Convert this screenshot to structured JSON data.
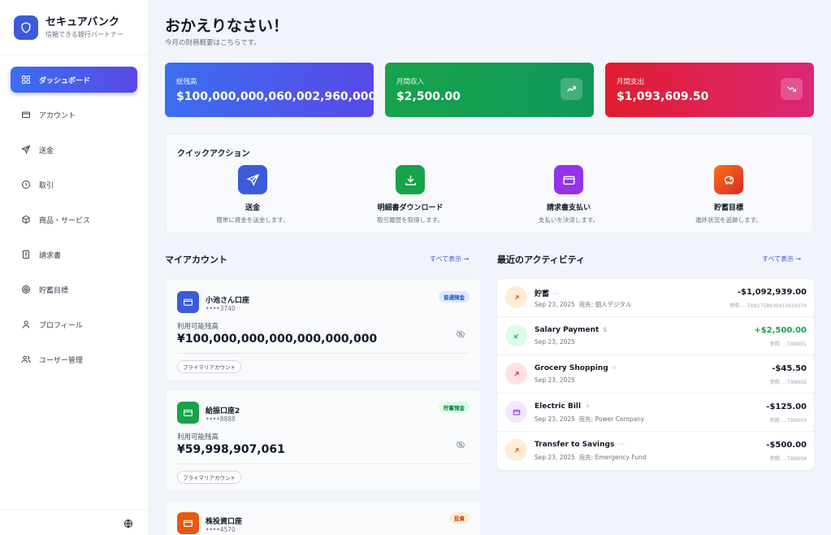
{
  "brand": {
    "title": "セキュアバンク",
    "subtitle": "信頼できる銀行パートナー"
  },
  "nav": [
    {
      "label": "ダッシュボード",
      "icon": "dashboard-icon",
      "active": true
    },
    {
      "label": "アカウント",
      "icon": "card-icon"
    },
    {
      "label": "送金",
      "icon": "send-icon"
    },
    {
      "label": "取引",
      "icon": "clock-icon"
    },
    {
      "label": "商品・サービス",
      "icon": "package-icon"
    },
    {
      "label": "請求書",
      "icon": "receipt-icon"
    },
    {
      "label": "貯蓄目標",
      "icon": "target-icon"
    },
    {
      "label": "プロフィール",
      "icon": "user-icon"
    },
    {
      "label": "ユーザー管理",
      "icon": "users-icon"
    }
  ],
  "header": {
    "greeting": "おかえりなさい！",
    "subtitle": "今月の財務概要はこちらです。"
  },
  "stats": [
    {
      "label": "総残高",
      "value": "$100,000,000,060,002,960,000.00",
      "colors": [
        "#3b6ef0",
        "#5849e6"
      ]
    },
    {
      "label": "月間収入",
      "value": "$2,500.00",
      "icon": "trending-up-icon",
      "colors": [
        "#16a34a",
        "#10985a"
      ]
    },
    {
      "label": "月間支出",
      "value": "$1,093,609.50",
      "icon": "trending-down-icon",
      "colors": [
        "#e11d2e",
        "#db2777"
      ]
    }
  ],
  "quick_actions": {
    "title": "クイックアクション",
    "items": [
      {
        "label": "送金",
        "desc": "簡単に資金を送金します。",
        "icon": "send-icon",
        "color": "#3b5bdb"
      },
      {
        "label": "明細書ダウンロード",
        "desc": "取引履歴を取得します。",
        "icon": "download-icon",
        "color": "#16a34a"
      },
      {
        "label": "請求書支払い",
        "desc": "支払いを決済します。",
        "icon": "card-icon",
        "color": "#9333ea"
      },
      {
        "label": "貯蓄目標",
        "desc": "進捗状況を追跡します。",
        "icon": "piggy-bank-icon",
        "color": "#ea580c"
      }
    ]
  },
  "accounts": {
    "title": "マイアカウント",
    "see_all": "すべて表示 →",
    "balance_label": "利用可能残高",
    "items": [
      {
        "name": "小池さん口座",
        "number": "••••3740",
        "badge": "普通預金",
        "badge_bg": "#dbeafe",
        "badge_fg": "#1d4ed8",
        "balance": "¥100,000,000,000,000,000,000",
        "tag": "プライマリアカウント",
        "color": "#3b5bdb"
      },
      {
        "name": "給振口座2",
        "number": "••••8888",
        "badge": "貯蓄預金",
        "badge_bg": "#dcfce7",
        "badge_fg": "#15803d",
        "balance": "¥59,998,907,061",
        "tag": "プライマリアカウント",
        "color": "#16a34a"
      },
      {
        "name": "株投資口座",
        "number": "••••4570",
        "badge": "投資",
        "badge_bg": "#ffedd5",
        "badge_fg": "#c2410c",
        "color": "#ea580c"
      }
    ]
  },
  "activity": {
    "title": "最近のアクティビティ",
    "see_all": "すべて表示 →",
    "items": [
      {
        "title": "貯蓄",
        "mini": "···",
        "date": "Sep 23, 2025",
        "party": "宛先: 個人デジタル",
        "amount": "-$1,092,939.00",
        "ref": "参照: ...TXN1758630415634379",
        "positive": false,
        "icon": "arrow-up-right-icon",
        "bg": "#ffedd5",
        "fg": "#ea580c"
      },
      {
        "title": "Salary Payment",
        "mini": "$",
        "date": "Sep 23, 2025",
        "party": "",
        "amount": "+$2,500.00",
        "ref": "参照: ...TXN001",
        "positive": true,
        "icon": "arrow-down-left-icon",
        "bg": "#dcfce7",
        "fg": "#16a34a"
      },
      {
        "title": "Grocery Shopping",
        "mini": "⑂",
        "date": "Sep 23, 2025",
        "party": "",
        "amount": "-$45.50",
        "ref": "参照: ...TXN002",
        "positive": false,
        "icon": "arrow-up-right-icon",
        "bg": "#fee2e2",
        "fg": "#dc2626"
      },
      {
        "title": "Electric Bill",
        "mini": "✧",
        "date": "Sep 23, 2025",
        "party": "宛先: Power Company",
        "amount": "-$125.00",
        "ref": "参照: ...TXN003",
        "positive": false,
        "icon": "card-icon",
        "bg": "#f3e8ff",
        "fg": "#9333ea"
      },
      {
        "title": "Transfer to Savings",
        "mini": "···",
        "date": "Sep 23, 2025",
        "party": "宛先: Emergency Fund",
        "amount": "-$500.00",
        "ref": "参照: ...TXN004",
        "positive": false,
        "icon": "arrow-up-right-icon",
        "bg": "#ffedd5",
        "fg": "#ea580c"
      }
    ]
  },
  "colors": {
    "accent": "#3b5bdb",
    "positive": "#16a34a",
    "negative": "#111827"
  }
}
